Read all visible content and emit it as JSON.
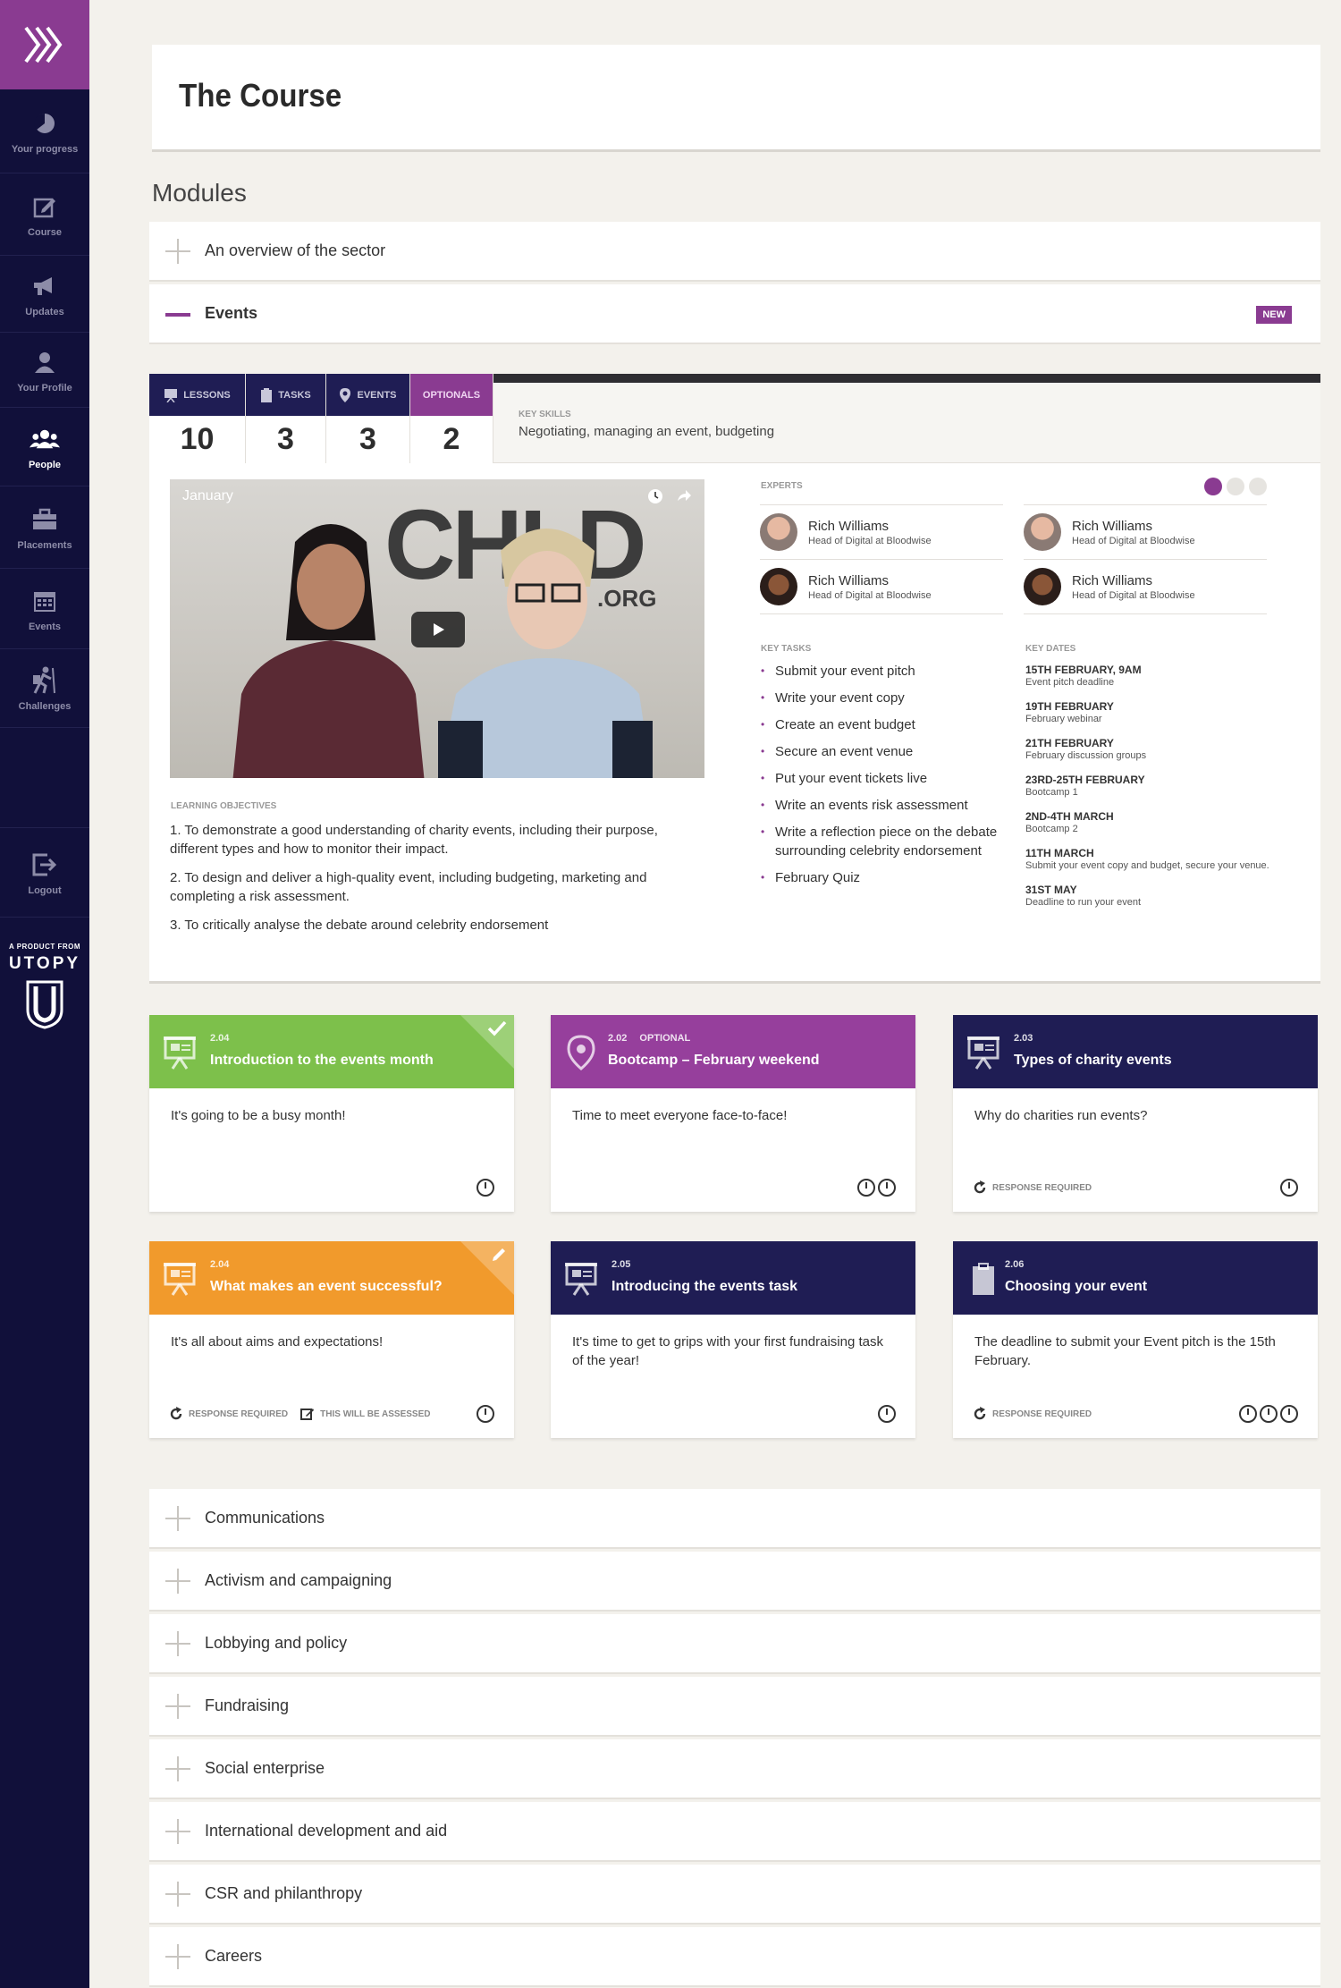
{
  "sidebar": {
    "items": [
      {
        "label": "Your progress",
        "icon": "progress-icon"
      },
      {
        "label": "Course",
        "icon": "edit-icon"
      },
      {
        "label": "Updates",
        "icon": "megaphone-icon"
      },
      {
        "label": "Your Profile",
        "icon": "user-icon"
      },
      {
        "label": "People",
        "icon": "people-icon",
        "active": true
      },
      {
        "label": "Placements",
        "icon": "briefcase-icon"
      },
      {
        "label": "Events",
        "icon": "calendar-icon"
      },
      {
        "label": "Challenges",
        "icon": "climber-icon"
      }
    ],
    "logout_label": "Logout",
    "brand_small": "A PRODUCT FROM",
    "brand_big": "UTOPY"
  },
  "page": {
    "title": "The Course",
    "modules_heading": "Modules"
  },
  "accordion_top": [
    {
      "label": "An overview of the sector",
      "open": false
    },
    {
      "label": "Events",
      "open": true,
      "badge": "NEW"
    }
  ],
  "module": {
    "stats": [
      {
        "label": "LESSONS",
        "value": "10"
      },
      {
        "label": "TASKS",
        "value": "3"
      },
      {
        "label": "EVENTS",
        "value": "3"
      },
      {
        "label": "OPTIONALS",
        "value": "2"
      }
    ],
    "key_skills_label": "KEY SKILLS",
    "key_skills": "Negotiating, managing an event, budgeting",
    "video": {
      "title": "January",
      "wall_text": "CHLD",
      "wall_sub": ".ORG"
    },
    "learning_objectives_label": "LEARNING OBJECTIVES",
    "learning_objectives": [
      "1. To demonstrate a good understanding of charity events, including their purpose, different types and how to monitor their impact.",
      "2. To design and deliver a high-quality event, including budgeting, marketing and completing a risk assessment.",
      "3. To critically analyse the debate around celebrity endorsement"
    ],
    "experts_label": "EXPERTS",
    "experts": [
      {
        "name": "Rich Williams",
        "role": "Head of Digital at Bloodwise"
      },
      {
        "name": "Rich Williams",
        "role": "Head of Digital at Bloodwise"
      },
      {
        "name": "Rich Williams",
        "role": "Head of Digital at Bloodwise"
      },
      {
        "name": "Rich Williams",
        "role": "Head of Digital at Bloodwise"
      }
    ],
    "key_tasks_label": "KEY TASKS",
    "key_tasks": [
      "Submit your event pitch",
      "Write your event copy",
      "Create an event budget",
      "Secure an event venue",
      "Put your event tickets live",
      "Write an events risk assessment",
      "Write a reflection piece on the debate surrounding celebrity endorsement",
      "February Quiz"
    ],
    "key_dates_label": "KEY DATES",
    "key_dates": [
      {
        "date": "15TH FEBRUARY, 9AM",
        "text": "Event pitch deadline"
      },
      {
        "date": "19TH FEBRUARY",
        "text": "February webinar"
      },
      {
        "date": "21TH FEBRUARY",
        "text": "February discussion groups"
      },
      {
        "date": "23RD-25TH FEBRUARY",
        "text": "Bootcamp 1"
      },
      {
        "date": "2ND-4TH MARCH",
        "text": "Bootcamp 2"
      },
      {
        "date": "11TH MARCH",
        "text": "Submit your event copy and budget, secure your venue."
      },
      {
        "date": "31ST MAY",
        "text": "Deadline to run your event"
      }
    ]
  },
  "cards": [
    {
      "num": "2.04",
      "optional": "",
      "title": "Introduction to the events month",
      "body": "It's going to be a busy month!",
      "color": "#7dc04b",
      "icon": "presentation-icon",
      "corner": "check-icon",
      "response": "",
      "assessed": "",
      "clocks": 1
    },
    {
      "num": "2.02",
      "optional": "OPTIONAL",
      "title": "Bootcamp – February weekend",
      "body": "Time to meet everyone face-to-face!",
      "color": "#963f9c",
      "icon": "location-pin-icon",
      "corner": "",
      "response": "",
      "assessed": "",
      "clocks": 2
    },
    {
      "num": "2.03",
      "optional": "",
      "title": "Types of charity events",
      "body": "Why do charities run events?",
      "color": "#1f1d54",
      "icon": "presentation-icon",
      "corner": "",
      "response": "RESPONSE REQUIRED",
      "assessed": "",
      "clocks": 1
    },
    {
      "num": "2.04",
      "optional": "",
      "title": "What makes an event successful?",
      "body": "It's all about aims and expectations!",
      "color": "#f19a2c",
      "icon": "presentation-icon",
      "corner": "pencil-icon",
      "response": "RESPONSE REQUIRED",
      "assessed": "THIS WILL BE ASSESSED",
      "clocks": 1
    },
    {
      "num": "2.05",
      "optional": "",
      "title": "Introducing the events task",
      "body": "It's time to get to grips with your first fundraising task of the year!",
      "color": "#1f1d54",
      "icon": "presentation-icon",
      "corner": "",
      "response": "",
      "assessed": "",
      "clocks": 1
    },
    {
      "num": "2.06",
      "optional": "",
      "title": "Choosing your event",
      "body": "The deadline to submit your Event pitch is the 15th February.",
      "color": "#1f1d54",
      "icon": "clipboard-icon",
      "corner": "",
      "response": "RESPONSE REQUIRED",
      "assessed": "",
      "clocks": 3
    }
  ],
  "accordion_bottom": [
    "Communications",
    "Activism and campaigning",
    "Lobbying and policy",
    "Fundraising",
    "Social enterprise",
    "International development and aid",
    "CSR and philanthropy",
    "Careers"
  ]
}
